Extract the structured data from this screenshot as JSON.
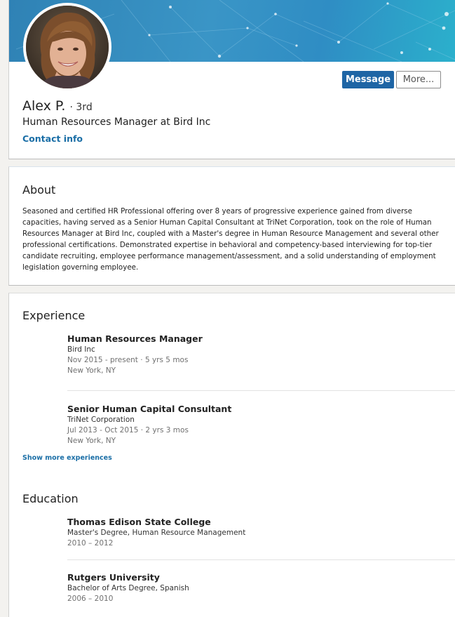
{
  "profile": {
    "name": "Alex P.",
    "degree": "· 3rd",
    "headline": "Human Resources Manager at Bird Inc",
    "contact_label": "Contact info",
    "message_label": "Message",
    "more_label": "More..."
  },
  "about": {
    "title": "About",
    "text": "Seasoned and certified HR Professional offering over 8 years of progressive experience gained from diverse capacities, having served as a Senior Human Capital Consultant at TriNet Corporation, took on the role of Human Resources Manager at Bird Inc, coupled with a Master's degree in Human Resource Management and several other professional certifications. Demonstrated expertise in behavioral and competency-based interviewing for top-tier candidate recruiting, employee performance management/assessment, and a solid understanding of employment legislation governing employee."
  },
  "experience": {
    "title": "Experience",
    "items": [
      {
        "title": "Human Resources Manager",
        "company": "Bird Inc",
        "dates": "Nov 2015 - present · 5 yrs 5 mos",
        "location": "New York, NY"
      },
      {
        "title": "Senior Human Capital Consultant",
        "company": "TriNet Corporation",
        "dates": "Jul 2013 - Oct 2015 · 2 yrs 3 mos",
        "location": "New York, NY"
      }
    ],
    "show_more_label": "Show more experiences"
  },
  "education": {
    "title": "Education",
    "items": [
      {
        "school": "Thomas Edison State College",
        "degree": "Master's Degree, Human Resource Management",
        "dates": "2010 – 2012"
      },
      {
        "school": "Rutgers University",
        "degree": "Bachelor of Arts Degree, Spanish",
        "dates": "2006 – 2010"
      }
    ]
  },
  "colors": {
    "accent": "#1e65a5",
    "link": "#1a6ea6",
    "banner": "#3a95c6"
  }
}
